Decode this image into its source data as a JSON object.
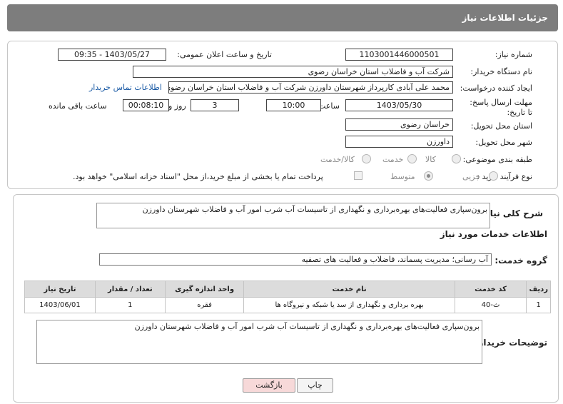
{
  "header": {
    "title": "جزئیات اطلاعات نیاز"
  },
  "fields": {
    "need_number_label": "شماره نیاز:",
    "need_number": "1103001446000501",
    "announce_label": "تاریخ و ساعت اعلان عمومی:",
    "announce_value": "1403/05/27 - 09:35",
    "buyer_org_label": "نام دستگاه خریدار:",
    "buyer_org": "شرکت آب و فاضلاب استان خراسان رضوی",
    "requester_label": "ایجاد کننده درخواست:",
    "requester": "محمد علی آبادی کارپرداز شهرستان داورزن  شرکت آب و فاضلاب استان خراسان رضوی",
    "contact_link": "اطلاعات تماس خریدار",
    "deadline_label": "مهلت ارسال پاسخ: تا تاریخ:",
    "deadline_date": "1403/05/30",
    "hour_label": "ساعت",
    "deadline_time": "10:00",
    "days_value": "3",
    "days_label": "روز و",
    "remaining_time": "00:08:10",
    "remaining_label": "ساعت باقی مانده",
    "province_label": "استان محل تحویل:",
    "province": "خراسان رضوی",
    "city_label": "شهر محل تحویل:",
    "city": "داورزن",
    "category_label": "طبقه بندی موضوعی:",
    "category_options": [
      "کالا",
      "خدمت",
      "کالا/خدمت"
    ],
    "process_label": "نوع فرآیند خرید :",
    "process_options": [
      "جزیی",
      "متوسط"
    ],
    "payment_note": "پرداخت تمام یا بخشی از مبلغ خرید،از محل \"اسناد خزانه اسلامی\" خواهد بود."
  },
  "summary": {
    "label": "شرح کلی نیاز:",
    "text": "برون‌سپاری فعالیت‌های بهره‌برداری و نگهداری از تاسیسات آب شرب امور آب و فاضلاب شهرستان داورزن"
  },
  "services": {
    "title": "اطلاعات خدمات مورد نیاز",
    "group_label": "گروه خدمت:",
    "group_value": "آب رسانی؛ مدیریت پسماند، فاضلاب و فعالیت های تصفیه",
    "columns": [
      "ردیف",
      "کد خدمت",
      "نام خدمت",
      "واحد اندازه گیری",
      "تعداد / مقدار",
      "تاریخ نیاز"
    ],
    "rows": [
      [
        "1",
        "ث-40",
        "بهره برداری و نگهداری از سد یا شبکه و نیروگاه ها",
        "فقره",
        "1",
        "1403/06/01"
      ]
    ]
  },
  "buyer_notes": {
    "label": "توضیحات خریدار:",
    "text": "برون‌سپاری فعالیت‌های بهره‌برداری و نگهداری از تاسیسات آب شرب امور آب و فاضلاب شهرستان داورزن"
  },
  "buttons": {
    "print": "چاپ",
    "back": "بازگشت"
  },
  "colors": {
    "header_bg": "#7d7d7d",
    "link": "#1a5aa5",
    "back_button": "#f7d9d9"
  }
}
